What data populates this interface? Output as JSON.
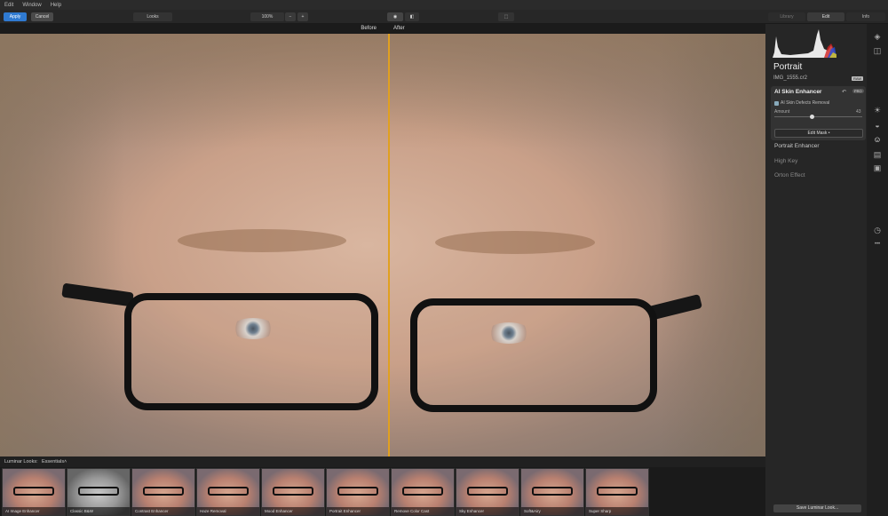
{
  "menu": [
    "Edit",
    "Window",
    "Help"
  ],
  "toolbar": {
    "apply": "Apply",
    "cancel": "Cancel",
    "looks": "Looks",
    "zoom": "100%",
    "zoom_minus": "−",
    "zoom_plus": "+",
    "eye": "◉",
    "compare": "◧",
    "crop": "⬚",
    "tabs": [
      "Library",
      "Edit",
      "Info"
    ]
  },
  "compare": {
    "before": "Before",
    "after": "After"
  },
  "looks_bar": {
    "label": "Luminar Looks:",
    "category": "Essentials",
    "arrow": "˄"
  },
  "looks": [
    {
      "name": "AI Image Enhancer",
      "gray": false
    },
    {
      "name": "Classic B&W",
      "gray": true
    },
    {
      "name": "Contrast Enhancer",
      "gray": false
    },
    {
      "name": "Haze Removal",
      "gray": false
    },
    {
      "name": "Mood Enhancer",
      "gray": false
    },
    {
      "name": "Portrait Enhancer",
      "gray": false
    },
    {
      "name": "Remove Color Cast",
      "gray": false
    },
    {
      "name": "Sky Enhancer",
      "gray": false
    },
    {
      "name": "Soft&Airy",
      "gray": false
    },
    {
      "name": "Super Sharp",
      "gray": false
    }
  ],
  "panel": {
    "title": "Portrait",
    "filename": "IMG_1555.cr2",
    "raw_badge": "RAW",
    "filter": {
      "title": "AI Skin Enhancer",
      "undo": "↶",
      "pro": "PRO",
      "checkbox_label": "AI Skin Defects Removal",
      "checked": true,
      "amount_label": "Amount",
      "amount_value": "43",
      "amount": 43,
      "edit_mask": "Edit Mask •"
    },
    "items": [
      {
        "label": "Portrait Enhancer",
        "active": true
      },
      {
        "label": "High Key",
        "active": false
      },
      {
        "label": "Orton Effect",
        "active": false
      }
    ],
    "save_button": "Save Luminar Look..."
  },
  "rail_icons": [
    {
      "name": "layers-icon",
      "glyph": "◈"
    },
    {
      "name": "columns-icon",
      "glyph": "◫"
    },
    {
      "name": "sun-icon",
      "glyph": "☀"
    },
    {
      "name": "palette-icon",
      "glyph": "◒"
    },
    {
      "name": "face-icon",
      "glyph": "☺"
    },
    {
      "name": "pro-icon",
      "glyph": "▤"
    },
    {
      "name": "briefcase-icon",
      "glyph": "▣"
    },
    {
      "name": "history-icon",
      "glyph": "◷"
    },
    {
      "name": "more-icon",
      "glyph": "•••"
    }
  ],
  "colors": {
    "accent": "#2f7ad1",
    "divider": "#e0a020"
  }
}
